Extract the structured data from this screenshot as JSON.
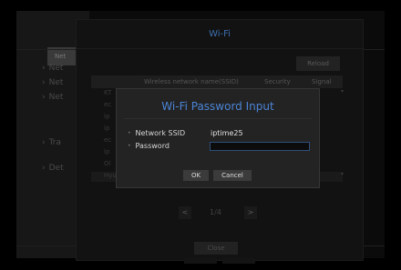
{
  "background": {
    "tab_label": "Net",
    "menu": [
      {
        "label": "Net"
      },
      {
        "label": "Net"
      },
      {
        "label": "Net"
      },
      {
        "label": "Tra"
      },
      {
        "label": "Det"
      }
    ]
  },
  "wifi_dialog": {
    "title": "Wi-Fi",
    "reload_label": "Reload",
    "columns": {
      "ssid": "Wireless network name(SSID)",
      "security": "Security",
      "signal": "Signal"
    },
    "rows": [
      {
        "ssid": "KT"
      },
      {
        "ssid": "ec"
      },
      {
        "ssid": "ip"
      },
      {
        "ssid": "ip"
      },
      {
        "ssid": "ec"
      },
      {
        "ssid": "ip"
      },
      {
        "ssid": "Ol"
      },
      {
        "ssid": "Hyunseok.nt"
      }
    ],
    "pager": {
      "prev": "<",
      "page": "1/4",
      "next": ">"
    },
    "close_label": "Close"
  },
  "password_dialog": {
    "title": "Wi-Fi Password Input",
    "ssid_label": "Network SSID",
    "ssid_value": "iptime25",
    "password_label": "Password",
    "password_value": "",
    "ok_label": "OK",
    "cancel_label": "Cancel"
  },
  "colors": {
    "accent_title": "#4b84d6",
    "dialog_bg": "#232323",
    "input_border": "#2f4f7a"
  },
  "icons": {
    "bullet": "bullet-dot-icon",
    "chevron": "chevron-right-icon",
    "signal": "signal-bar-icon",
    "security": "lock-icon"
  }
}
